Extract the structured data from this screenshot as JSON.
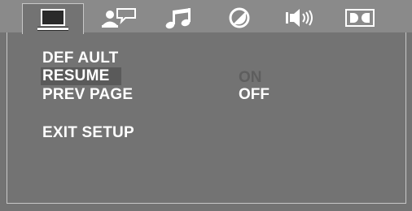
{
  "tabs": [
    {
      "icon": "monitor-icon",
      "active": true
    },
    {
      "icon": "speaking-person-icon",
      "active": false
    },
    {
      "icon": "music-note-icon",
      "active": false
    },
    {
      "icon": "circle-slash-icon",
      "active": false
    },
    {
      "icon": "speaker-sound-icon",
      "active": false
    },
    {
      "icon": "dolby-icon",
      "active": false
    }
  ],
  "menu": {
    "default_label": "DEF AULT",
    "resume_label": "RESUME",
    "resume_value": "ON",
    "prev_page_label": "PREV PAGE",
    "prev_page_value": "OFF",
    "exit_label": "EXIT  SETUP"
  },
  "colors": {
    "screen_bg": "#737373",
    "tabbar_bg": "#8a8a8a",
    "text": "#ffffff",
    "dim_value": "#5e5e5e",
    "selection": "#5a5a5a"
  }
}
